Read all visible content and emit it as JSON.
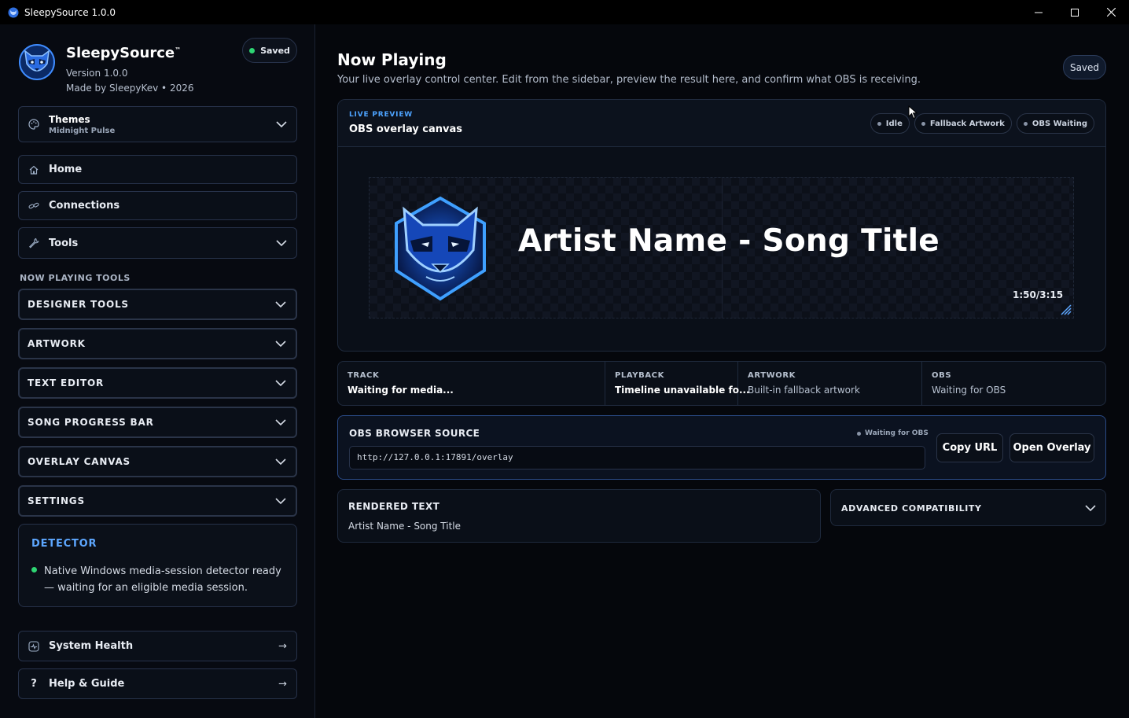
{
  "window": {
    "title": "SleepySource 1.0.0",
    "controls": [
      "minimize",
      "maximize",
      "close"
    ]
  },
  "brand": {
    "name": "SleepySource",
    "trademark": "™",
    "version": "Version 1.0.0",
    "made_by": "Made by SleepyKev • 2026",
    "saved_label": "Saved"
  },
  "themes": {
    "title": "Themes",
    "current": "Midnight Pulse"
  },
  "nav": {
    "home": "Home",
    "connections": "Connections",
    "tools": "Tools"
  },
  "tools_section": {
    "label": "NOW PLAYING TOOLS",
    "items": [
      "DESIGNER TOOLS",
      "ARTWORK",
      "TEXT EDITOR",
      "SONG PROGRESS BAR",
      "OVERLAY CANVAS",
      "SETTINGS"
    ]
  },
  "detector": {
    "title": "DETECTOR",
    "message": "Native Windows media-session detector ready — waiting for an eligible media session."
  },
  "footer_nav": {
    "system_health": "System Health",
    "help": "Help & Guide",
    "arrow": "→",
    "help_glyph": "?"
  },
  "main": {
    "title": "Now Playing",
    "subtitle": "Your live overlay control center. Edit from the sidebar, preview the result here, and confirm what OBS is receiving.",
    "saved_label": "Saved"
  },
  "preview": {
    "tag": "LIVE PREVIEW",
    "title": "OBS overlay canvas",
    "chips": [
      "Idle",
      "Fallback Artwork",
      "OBS Waiting"
    ],
    "song_text": "Artist Name - Song Title",
    "time": "1:50/3:15"
  },
  "info": [
    {
      "label": "TRACK",
      "value": "Waiting for media..."
    },
    {
      "label": "PLAYBACK",
      "value": "Timeline unavailable fo..."
    },
    {
      "label": "ARTWORK",
      "value": "Built-in fallback artwork"
    },
    {
      "label": "OBS",
      "value": "Waiting for OBS"
    }
  ],
  "obs_source": {
    "title": "OBS BROWSER SOURCE",
    "status": "Waiting for OBS",
    "url": "http://127.0.0.1:17891/overlay",
    "copy_label": "Copy URL",
    "open_label": "Open Overlay"
  },
  "rendered": {
    "title": "RENDERED TEXT",
    "value": "Artist Name - Song Title"
  },
  "advanced": {
    "title": "ADVANCED COMPATIBILITY"
  },
  "colors": {
    "accent": "#4da3ff",
    "saved_dot": "#2ed573",
    "obs_border": "#2a4a86",
    "background": "#05070c"
  }
}
